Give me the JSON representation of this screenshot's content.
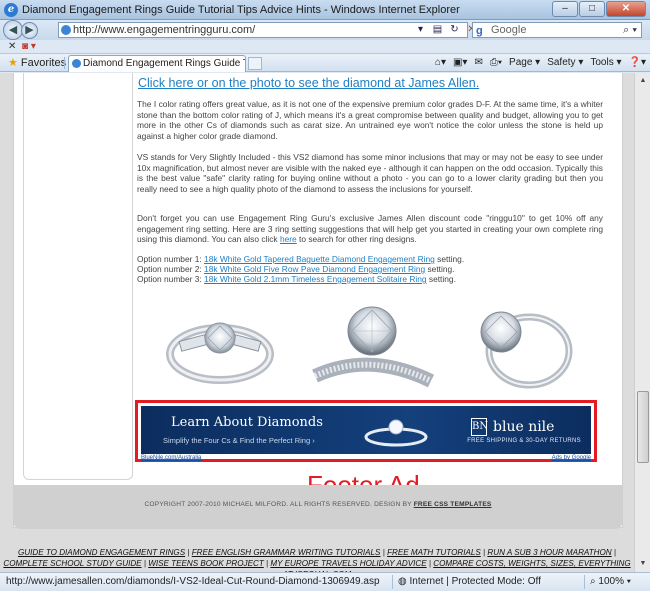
{
  "window": {
    "title": "Diamond Engagement Rings Guide Tutorial Tips Advice Hints - Windows Internet Explorer",
    "minimize": "–",
    "maximize": "□",
    "close": "✕"
  },
  "toolbar": {
    "back": "◀",
    "forward": "▶",
    "address": "http://www.engagementringguru.com/",
    "search_engine": "Google",
    "search_placeholder": "Google"
  },
  "tabbar": {
    "favorites_label": "Favorites",
    "active_tab": "Diamond Engagement Rings Guide Tutorial Tips ...",
    "page_menu": "Page ▾",
    "safety_menu": "Safety ▾",
    "tools_menu": "Tools ▾",
    "help_menu": "❓▾"
  },
  "content": {
    "cta_link": "Click here or on the photo to see the diamond at James Allen.",
    "para_color": "The I color rating offers great value, as it is not one of the expensive premium color grades D-F. At the same time, it's a whiter stone than the bottom color rating of J, which means it's a great compromise between quality and budget, allowing you to get more in the other Cs of diamonds such as carat size. An untrained eye won't notice the color unless the stone is held up against a higher color grade diamond.",
    "para_clarity": "VS stands for Very Slightly Included - this VS2 diamond has some minor inclusions that may or may not be easy to see under 10x magnification, but almost never are visible with the naked eye - although it can happen on the odd occasion. Typically this is the best value \"safe\" clarity rating for buying online without a photo - you can go to a lower clarity grading but then you really need to see a high quality photo of the diamond to assess the inclusions for yourself.",
    "para_discount_before": "Don't forget you can use Engagement Ring Guru's exclusive James Allen discount code \"ringgu10\" to get 10% off any engagement ring setting. Here are 3 ring setting suggestions that will help get you started in creating your own complete ring using this diamond. You can also click ",
    "para_discount_link": "here",
    "para_discount_after": " to search for other ring designs.",
    "options": [
      {
        "prefix": "Option number 1: ",
        "link": "18k White Gold Tapered Baguette Diamond Engagement Ring",
        "suffix": " setting."
      },
      {
        "prefix": "Option number 2: ",
        "link": "18k White Gold Five Row Pave Diamond Engagement Ring",
        "suffix": " setting."
      },
      {
        "prefix": "Option number 3: ",
        "link": "18k White Gold 2.1mm Timeless Engagement Solitaire Ring",
        "suffix": " setting."
      }
    ]
  },
  "ad": {
    "headline": "Learn About Diamonds",
    "subline": "Simplify the Four Cs & Find the Perfect Ring ›",
    "brand": "blue nile",
    "brand_mark": "BN",
    "shipping": "FREE SHIPPING & 30-DAY RETURNS",
    "source": "BlueNile.com/Australia",
    "ads_by": "Ads by Google"
  },
  "annotation": {
    "label": "Footer Ad",
    "color": "#e31c23"
  },
  "footer": {
    "copyright_prefix": "COPYRIGHT 2007-2010 MICHAEL MILFORD. ALL RIGHTS RESERVED. DESIGN BY ",
    "copyright_link": "FREE CSS TEMPLATES",
    "links": [
      "GUIDE TO DIAMOND ENGAGEMENT RINGS",
      "FREE ENGLISH GRAMMAR WRITING TUTORIALS",
      "FREE MATH TUTORIALS",
      "RUN A SUB 3 HOUR MARATHON",
      "COMPLETE SCHOOL STUDY GUIDE",
      "WISE TEENS BOOK PROJECT",
      "MY EUROPE TRAVELS HOLIDAY ADVICE",
      "COMPARE COSTS, WEIGHTS, SIZES, EVERYTHING AT ISEQUAL.COM"
    ],
    "separator": " | "
  },
  "status": {
    "url": "http://www.jamesallen.com/diamonds/I-VS2-Ideal-Cut-Round-Diamond-1306949.asp",
    "zone": "Internet | Protected Mode: Off",
    "zoom": "100%"
  },
  "colors": {
    "link": "#1f7fc4",
    "annotation_red": "#e31c23",
    "ad_navy": "#0c2d5e"
  }
}
